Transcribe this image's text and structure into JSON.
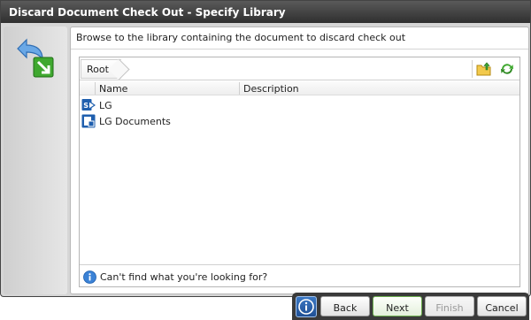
{
  "window": {
    "title": "Discard Document Check Out - Specify Library"
  },
  "main": {
    "instruction": "Browse to the library containing the document to discard check out"
  },
  "browser": {
    "breadcrumb": "Root",
    "columns": {
      "name": "Name",
      "description": "Description"
    },
    "items": [
      {
        "name": "LG",
        "icon": "sharepoint-site-icon"
      },
      {
        "name": "LG Documents",
        "icon": "document-library-icon"
      }
    ],
    "help_text": "Can't find what you're looking for?"
  },
  "buttons": {
    "back": "Back",
    "next": "Next",
    "finish": "Finish",
    "cancel": "Cancel"
  },
  "colors": {
    "titlebar": "#3d3d3d",
    "accent_blue": "#1f5fae",
    "next_border": "#6cae4e"
  }
}
